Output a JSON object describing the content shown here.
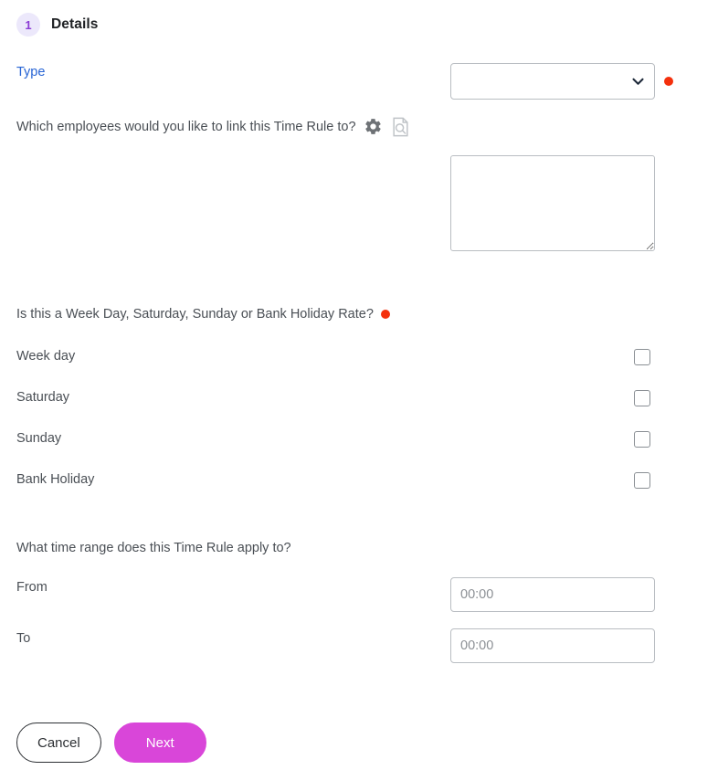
{
  "step": {
    "number": "1",
    "title": "Details",
    "badge_bg": "#ece8fb",
    "badge_color": "#8b3bd4"
  },
  "form": {
    "type": {
      "label": "Type",
      "label_color": "#2764d4",
      "selected_value": "",
      "options": [
        ""
      ],
      "required": true
    },
    "employees": {
      "label": "Which employees would you like to link this Time Rule to?",
      "gear_icon": "gear-icon",
      "preview_icon": "document-search-icon",
      "value": "",
      "placeholder": ""
    },
    "rate_type": {
      "label": "Is this a Week Day, Saturday, Sunday or Bank Holiday Rate?",
      "required": true,
      "options": [
        {
          "label": "Week day",
          "checked": false
        },
        {
          "label": "Saturday",
          "checked": false
        },
        {
          "label": "Sunday",
          "checked": false
        },
        {
          "label": "Bank Holiday",
          "checked": false
        }
      ]
    },
    "time_range": {
      "label": "What time range does this Time Rule apply to?",
      "from": {
        "label": "From",
        "value": "",
        "placeholder": "00:00"
      },
      "to": {
        "label": "To",
        "value": "",
        "placeholder": "00:00"
      }
    }
  },
  "actions": {
    "cancel_label": "Cancel",
    "next_label": "Next",
    "next_color": "#d946d9"
  },
  "colors": {
    "required_dot": "#f4300c",
    "text": "#4a4f55",
    "border": "#b9bdc2"
  }
}
